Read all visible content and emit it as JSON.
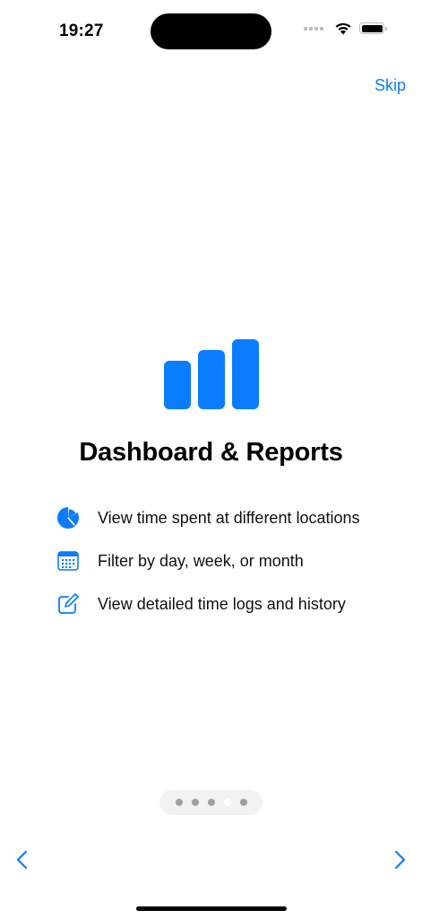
{
  "status_bar": {
    "time": "19:27"
  },
  "header": {
    "skip_label": "Skip"
  },
  "hero": {
    "icon": "chart-bar-icon",
    "title": "Dashboard & Reports"
  },
  "features": [
    {
      "icon": "pie-chart-icon",
      "text": "View time spent at different locations"
    },
    {
      "icon": "calendar-icon",
      "text": "Filter by day, week, or month"
    },
    {
      "icon": "edit-icon",
      "text": "View detailed time logs and history"
    }
  ],
  "pagination": {
    "total_pages": 5,
    "current_page": 4
  },
  "navigation": {
    "prev_icon": "chevron-left-icon",
    "next_icon": "chevron-right-icon"
  },
  "colors": {
    "accent": "#0a7cff",
    "text": "#111111",
    "indicator_bg": "#f2f2f4"
  }
}
